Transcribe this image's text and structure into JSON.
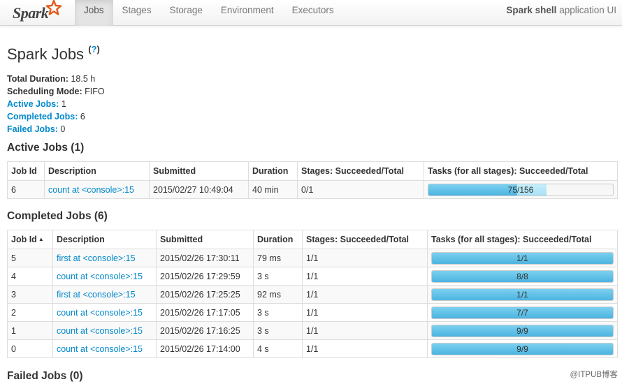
{
  "navbar": {
    "logo_text": "Spark",
    "tabs": [
      {
        "label": "Jobs",
        "active": true
      },
      {
        "label": "Stages",
        "active": false
      },
      {
        "label": "Storage",
        "active": false
      },
      {
        "label": "Environment",
        "active": false
      },
      {
        "label": "Executors",
        "active": false
      }
    ],
    "app_name_bold": "Spark shell",
    "app_name_suffix": " application UI"
  },
  "page": {
    "title": "Spark Jobs",
    "help_link": "?"
  },
  "summary": {
    "total_duration_label": "Total Duration:",
    "total_duration_value": "18.5 h",
    "scheduling_mode_label": "Scheduling Mode:",
    "scheduling_mode_value": "FIFO",
    "active_jobs_label": "Active Jobs:",
    "active_jobs_value": "1",
    "completed_jobs_label": "Completed Jobs:",
    "completed_jobs_value": "6",
    "failed_jobs_label": "Failed Jobs:",
    "failed_jobs_value": "0"
  },
  "active_jobs": {
    "heading": "Active Jobs (1)",
    "headers": [
      "Job Id",
      "Description",
      "Submitted",
      "Duration",
      "Stages: Succeeded/Total",
      "Tasks (for all stages): Succeeded/Total"
    ],
    "rows": [
      {
        "job_id": "6",
        "description": "count at <console>:15",
        "submitted": "2015/02/27 10:49:04",
        "duration": "40 min",
        "stages": "0/1",
        "tasks_text": "75/156",
        "tasks_done_fraction": 0.4808,
        "tasks_running_fraction": 0.1603
      }
    ]
  },
  "completed_jobs": {
    "heading": "Completed Jobs (6)",
    "headers": [
      "Job Id",
      "Description",
      "Submitted",
      "Duration",
      "Stages: Succeeded/Total",
      "Tasks (for all stages): Succeeded/Total"
    ],
    "sort_indicator": "▲",
    "rows": [
      {
        "job_id": "5",
        "description": "first at <console>:15",
        "submitted": "2015/02/26 17:30:11",
        "duration": "79 ms",
        "stages": "1/1",
        "tasks_text": "1/1",
        "tasks_done_fraction": 1
      },
      {
        "job_id": "4",
        "description": "count at <console>:15",
        "submitted": "2015/02/26 17:29:59",
        "duration": "3 s",
        "stages": "1/1",
        "tasks_text": "8/8",
        "tasks_done_fraction": 1
      },
      {
        "job_id": "3",
        "description": "first at <console>:15",
        "submitted": "2015/02/26 17:25:25",
        "duration": "92 ms",
        "stages": "1/1",
        "tasks_text": "1/1",
        "tasks_done_fraction": 1
      },
      {
        "job_id": "2",
        "description": "count at <console>:15",
        "submitted": "2015/02/26 17:17:05",
        "duration": "3 s",
        "stages": "1/1",
        "tasks_text": "7/7",
        "tasks_done_fraction": 1
      },
      {
        "job_id": "1",
        "description": "count at <console>:15",
        "submitted": "2015/02/26 17:16:25",
        "duration": "3 s",
        "stages": "1/1",
        "tasks_text": "9/9",
        "tasks_done_fraction": 1
      },
      {
        "job_id": "0",
        "description": "count at <console>:15",
        "submitted": "2015/02/26 17:14:00",
        "duration": "4 s",
        "stages": "1/1",
        "tasks_text": "9/9",
        "tasks_done_fraction": 1
      }
    ]
  },
  "failed_jobs": {
    "heading": "Failed Jobs (0)"
  },
  "watermark": "@ITPUB博客",
  "colors": {
    "link": "#0088cc",
    "progress_done": "#4cb4e0",
    "progress_running": "#a7e0f6",
    "logo_star": "#e25a1c"
  },
  "icons": {
    "logo_star": "star-icon",
    "sort": "sort-ascending-icon"
  }
}
